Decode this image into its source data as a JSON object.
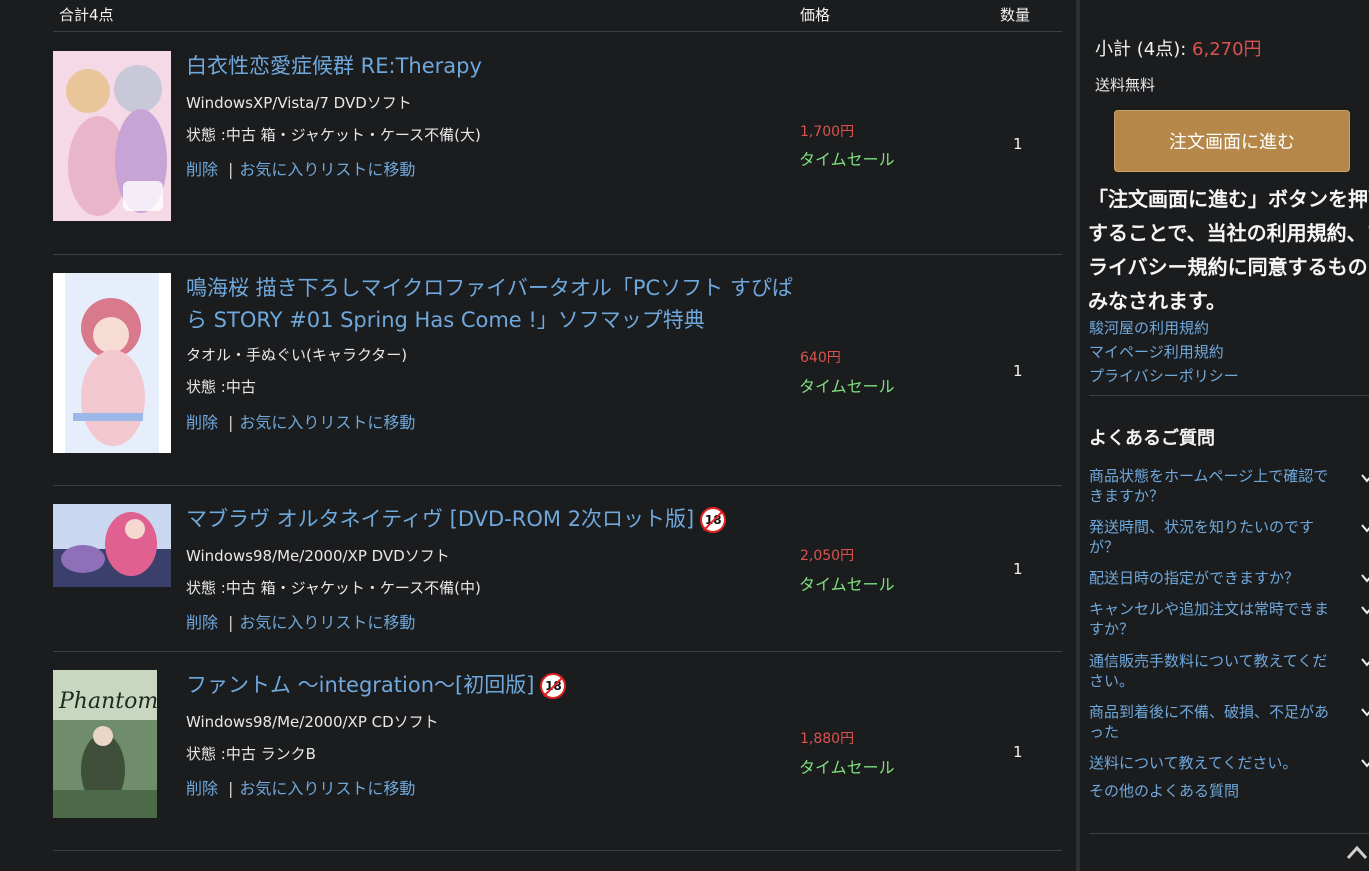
{
  "header": {
    "total": "合計4点",
    "price_col": "価格",
    "qty_col": "数量"
  },
  "items": [
    {
      "title": "白衣性恋愛症候群 RE:Therapy",
      "platform": "WindowsXP/Vista/7  DVDソフト",
      "condition": "状態 :中古 箱・ジャケット・ケース不備(大)",
      "delete": "削除",
      "wishlist": "お気に入りリストに移動",
      "price": "1,700円",
      "sale": "タイムセール",
      "qty": "1",
      "r18": false,
      "colors": [
        "#f6d9e6",
        "#c8a3d6",
        "#e9b6c9"
      ]
    },
    {
      "title": "鳴海桜 描き下ろしマイクロファイバータオル「PCソフト すぴぱら STORY #01 Spring Has Come !」ソフマップ特典",
      "platform": "タオル・手ぬぐい(キャラクター)",
      "condition": "状態 :中古",
      "delete": "削除",
      "wishlist": "お気に入りリストに移動",
      "price": "640円",
      "sale": "タイムセール",
      "qty": "1",
      "r18": false,
      "colors": [
        "#ffffff",
        "#f3c7cf",
        "#9bb8e8"
      ]
    },
    {
      "title": "マブラヴ オルタネイティヴ [DVD-ROM 2次ロット版]",
      "platform": "Windows98/Me/2000/XP  DVDソフト",
      "condition": "状態 :中古 箱・ジャケット・ケース不備(中)",
      "delete": "削除",
      "wishlist": "お気に入りリストに移動",
      "price": "2,050円",
      "sale": "タイムセール",
      "qty": "1",
      "r18": true,
      "r18_label": "18",
      "colors": [
        "#c9d8f0",
        "#8f6fb8",
        "#e06090"
      ]
    },
    {
      "title": "ファントム 〜integration〜[初回版]",
      "platform": "Windows98/Me/2000/XP  CDソフト",
      "condition": "状態 :中古 ランクB",
      "delete": "削除",
      "wishlist": "お気に入りリストに移動",
      "price": "1,880円",
      "sale": "タイムセール",
      "qty": "1",
      "r18": true,
      "r18_label": "18",
      "colors": [
        "#6f8d6a",
        "#3f4f3a",
        "#c9d6c0"
      ]
    }
  ],
  "sidebar": {
    "subtotal_label": "小計 (4点):",
    "subtotal_amount": "6,270円",
    "shipping": "送料無料",
    "order_button": "注文画面に進む",
    "notice": "「注文画面に進む」ボタンを押下することで、当社の利用規約、プライバシー規約に同意するものとみなされます。",
    "terms_links": [
      "駿河屋の利用規約",
      "マイページ利用規約",
      "プライバシーポリシー"
    ],
    "faq_title": "よくあるご質問",
    "faq": [
      "商品状態をホームページ上で確認できますか？",
      "発送時間、状況を知りたいのですが？",
      "配送日時の指定ができますか？",
      "キャンセルや追加注文は常時できますか？",
      "通信販売手数料について教えてください。",
      "商品到着後に不備、破損、不足があった",
      "送料について教えてください。",
      "その他のよくある質問"
    ]
  },
  "colors": {
    "background": "#1b1c1e",
    "link": "#6fa8dc",
    "price": "#d9534f",
    "sale": "#7ee07e",
    "button": "#b5884a"
  }
}
